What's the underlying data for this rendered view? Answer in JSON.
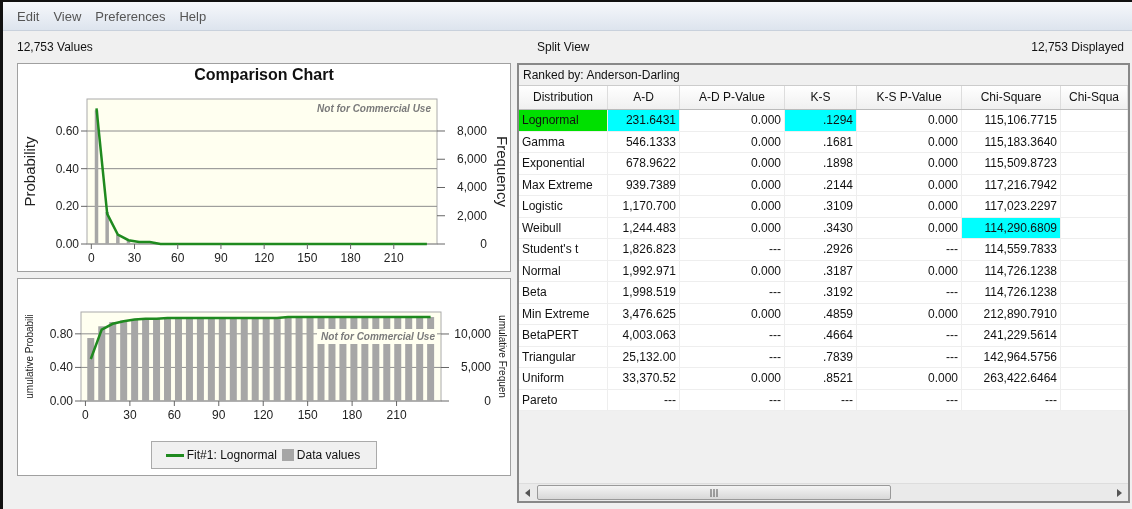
{
  "menu": [
    {
      "label": "Edit"
    },
    {
      "label": "View"
    },
    {
      "label": "Preferences"
    },
    {
      "label": "Help"
    }
  ],
  "info_bar": {
    "values": "12,753 Values",
    "view": "Split View",
    "displayed": "12,753 Displayed"
  },
  "charts": [
    {
      "chart_data": {
        "type": "bar",
        "title": "Comparison Chart",
        "ylabel": "Probability",
        "y2label": "Frequency",
        "grid": true,
        "x": [
          3.6,
          11,
          18.4,
          25.8,
          33.2,
          40.6,
          48,
          55.4,
          62.8,
          70.2,
          77.6,
          85,
          92.4,
          99.8,
          107.2,
          114.6,
          122,
          129.4,
          136.8,
          144.2,
          151.6,
          159,
          166.4,
          173.8,
          181.2,
          188.6,
          196,
          203.4,
          210.8,
          218.2,
          225.6,
          233
        ],
        "xlim": [
          -3,
          240
        ],
        "ylim": [
          0,
          0.77
        ],
        "y2lim": [
          0,
          10265
        ],
        "xticks": [
          0,
          30,
          60,
          90,
          120,
          150,
          180,
          210
        ],
        "yticks": [
          {
            "value": 0,
            "label": "0.00"
          },
          {
            "value": 0.2,
            "label": "0.20"
          },
          {
            "value": 0.4,
            "label": "0.40"
          },
          {
            "value": 0.6,
            "label": "0.60"
          }
        ],
        "y2ticks": [
          {
            "value": 0,
            "label": "0"
          },
          {
            "value": 2000,
            "label": "2,000"
          },
          {
            "value": 4000,
            "label": "4,000"
          },
          {
            "value": 6000,
            "label": "6,000"
          },
          {
            "value": 8000,
            "label": "8,000"
          }
        ],
        "annotations": [
          "Not for Commercial Use"
        ],
        "series": [
          {
            "type": "bar",
            "color": "#a6a6a6",
            "values": [
              0.71,
              0.17,
              0.05,
              0.02,
              0,
              0,
              0,
              0,
              0,
              0,
              0,
              0,
              0,
              0,
              0,
              0,
              0,
              0,
              0,
              0,
              0,
              0,
              0,
              0,
              0,
              0,
              0,
              0,
              0,
              0,
              0,
              0
            ]
          },
          {
            "type": "line",
            "color": "#1f8a1f",
            "values": [
              0.72,
              0.16,
              0.05,
              0.02,
              0.01,
              0.01,
              0,
              0,
              0,
              0,
              0,
              0,
              0,
              0,
              0,
              0,
              0,
              0,
              0,
              0,
              0,
              0,
              0,
              0,
              0,
              0,
              0,
              0,
              0,
              0,
              0,
              0
            ]
          }
        ]
      }
    },
    {
      "chart_data": {
        "type": "bar",
        "ylabel": "umulative Probabili",
        "y2label": "umulative Frequen",
        "grid": true,
        "x": [
          3.6,
          11,
          18.4,
          25.8,
          33.2,
          40.6,
          48,
          55.4,
          62.8,
          70.2,
          77.6,
          85,
          92.4,
          99.8,
          107.2,
          114.6,
          122,
          129.4,
          136.8,
          144.2,
          151.6,
          159,
          166.4,
          173.8,
          181.2,
          188.6,
          196,
          203.4,
          210.8,
          218.2,
          225.6,
          233
        ],
        "xlim": [
          -3,
          240
        ],
        "ylim": [
          0,
          1.06
        ],
        "y2lim": [
          0,
          13280
        ],
        "xticks": [
          0,
          30,
          60,
          90,
          120,
          150,
          180,
          210
        ],
        "yticks": [
          {
            "value": 0,
            "label": "0.00"
          },
          {
            "value": 0.4,
            "label": "0.40"
          },
          {
            "value": 0.8,
            "label": "0.80"
          }
        ],
        "y2ticks": [
          {
            "value": 0,
            "label": "0"
          },
          {
            "value": 5000,
            "label": "5,000"
          },
          {
            "value": 10000,
            "label": "10,000"
          }
        ],
        "annotations": [
          "Not for Commercial Use"
        ],
        "series": [
          {
            "name": "Fit#1: Lognormal",
            "type": "line",
            "color": "#1f8a1f",
            "values": [
              0.5,
              0.85,
              0.92,
              0.95,
              0.97,
              0.98,
              0.98,
              0.99,
              0.99,
              0.99,
              0.99,
              0.99,
              0.99,
              0.99,
              0.99,
              0.99,
              0.99,
              0.99,
              1,
              1,
              1,
              1,
              1,
              1,
              1,
              1,
              1,
              1,
              1,
              1,
              1,
              1
            ]
          },
          {
            "name": "Data values",
            "type": "bar",
            "color": "#a6a6a6",
            "values": [
              0.75,
              0.89,
              0.94,
              0.96,
              0.97,
              0.98,
              0.98,
              0.99,
              0.99,
              0.99,
              0.99,
              0.99,
              0.99,
              0.99,
              0.99,
              0.99,
              0.99,
              0.99,
              1,
              1,
              1,
              1,
              1,
              1,
              1,
              1,
              1,
              1,
              1,
              1,
              1,
              1
            ]
          }
        ]
      }
    }
  ],
  "table": {
    "ranked_by": "Ranked by: Anderson-Darling",
    "columns": [
      "Distribution",
      "A-D",
      "A-D P-Value",
      "K-S",
      "K-S P-Value",
      "Chi-Square",
      "Chi-Squa"
    ],
    "rows": [
      {
        "selected": true,
        "cells": [
          {
            "text": "Lognormal",
            "best": false
          },
          {
            "text": "231.6431",
            "best": true
          },
          {
            "text": "0.000",
            "best": false
          },
          {
            "text": ".1294",
            "best": true
          },
          {
            "text": "0.000",
            "best": false
          },
          {
            "text": "115,106.7715",
            "best": false
          }
        ]
      },
      {
        "selected": false,
        "cells": [
          {
            "text": "Gamma",
            "best": false
          },
          {
            "text": "546.1333",
            "best": false
          },
          {
            "text": "0.000",
            "best": false
          },
          {
            "text": ".1681",
            "best": false
          },
          {
            "text": "0.000",
            "best": false
          },
          {
            "text": "115,183.3640",
            "best": false
          }
        ]
      },
      {
        "selected": false,
        "cells": [
          {
            "text": "Exponential",
            "best": false
          },
          {
            "text": "678.9622",
            "best": false
          },
          {
            "text": "0.000",
            "best": false
          },
          {
            "text": ".1898",
            "best": false
          },
          {
            "text": "0.000",
            "best": false
          },
          {
            "text": "115,509.8723",
            "best": false
          }
        ]
      },
      {
        "selected": false,
        "cells": [
          {
            "text": "Max Extreme",
            "best": false
          },
          {
            "text": "939.7389",
            "best": false
          },
          {
            "text": "0.000",
            "best": false
          },
          {
            "text": ".2144",
            "best": false
          },
          {
            "text": "0.000",
            "best": false
          },
          {
            "text": "117,216.7942",
            "best": false
          }
        ]
      },
      {
        "selected": false,
        "cells": [
          {
            "text": "Logistic",
            "best": false
          },
          {
            "text": "1,170.700",
            "best": false
          },
          {
            "text": "0.000",
            "best": false
          },
          {
            "text": ".3109",
            "best": false
          },
          {
            "text": "0.000",
            "best": false
          },
          {
            "text": "117,023.2297",
            "best": false
          }
        ]
      },
      {
        "selected": false,
        "cells": [
          {
            "text": "Weibull",
            "best": false
          },
          {
            "text": "1,244.483",
            "best": false
          },
          {
            "text": "0.000",
            "best": false
          },
          {
            "text": ".3430",
            "best": false
          },
          {
            "text": "0.000",
            "best": false
          },
          {
            "text": "114,290.6809",
            "best": true
          }
        ]
      },
      {
        "selected": false,
        "cells": [
          {
            "text": "Student's t",
            "best": false
          },
          {
            "text": "1,826.823",
            "best": false
          },
          {
            "text": "---",
            "best": false
          },
          {
            "text": ".2926",
            "best": false
          },
          {
            "text": "---",
            "best": false
          },
          {
            "text": "114,559.7833",
            "best": false
          }
        ]
      },
      {
        "selected": false,
        "cells": [
          {
            "text": "Normal",
            "best": false
          },
          {
            "text": "1,992.971",
            "best": false
          },
          {
            "text": "0.000",
            "best": false
          },
          {
            "text": ".3187",
            "best": false
          },
          {
            "text": "0.000",
            "best": false
          },
          {
            "text": "114,726.1238",
            "best": false
          }
        ]
      },
      {
        "selected": false,
        "cells": [
          {
            "text": "Beta",
            "best": false
          },
          {
            "text": "1,998.519",
            "best": false
          },
          {
            "text": "---",
            "best": false
          },
          {
            "text": ".3192",
            "best": false
          },
          {
            "text": "---",
            "best": false
          },
          {
            "text": "114,726.1238",
            "best": false
          }
        ]
      },
      {
        "selected": false,
        "cells": [
          {
            "text": "Min Extreme",
            "best": false
          },
          {
            "text": "3,476.625",
            "best": false
          },
          {
            "text": "0.000",
            "best": false
          },
          {
            "text": ".4859",
            "best": false
          },
          {
            "text": "0.000",
            "best": false
          },
          {
            "text": "212,890.7910",
            "best": false
          }
        ]
      },
      {
        "selected": false,
        "cells": [
          {
            "text": "BetaPERT",
            "best": false
          },
          {
            "text": "4,003.063",
            "best": false
          },
          {
            "text": "---",
            "best": false
          },
          {
            "text": ".4664",
            "best": false
          },
          {
            "text": "---",
            "best": false
          },
          {
            "text": "241,229.5614",
            "best": false
          }
        ]
      },
      {
        "selected": false,
        "cells": [
          {
            "text": "Triangular",
            "best": false
          },
          {
            "text": "25,132.00",
            "best": false
          },
          {
            "text": "---",
            "best": false
          },
          {
            "text": ".7839",
            "best": false
          },
          {
            "text": "---",
            "best": false
          },
          {
            "text": "142,964.5756",
            "best": false
          }
        ]
      },
      {
        "selected": false,
        "cells": [
          {
            "text": "Uniform",
            "best": false
          },
          {
            "text": "33,370.52",
            "best": false
          },
          {
            "text": "0.000",
            "best": false
          },
          {
            "text": ".8521",
            "best": false
          },
          {
            "text": "0.000",
            "best": false
          },
          {
            "text": "263,422.6464",
            "best": false
          }
        ]
      },
      {
        "selected": false,
        "cells": [
          {
            "text": "Pareto",
            "best": false
          },
          {
            "text": "---",
            "best": false
          },
          {
            "text": "---",
            "best": false
          },
          {
            "text": "---",
            "best": false
          },
          {
            "text": "---",
            "best": false
          },
          {
            "text": "---",
            "best": false
          }
        ]
      }
    ]
  }
}
